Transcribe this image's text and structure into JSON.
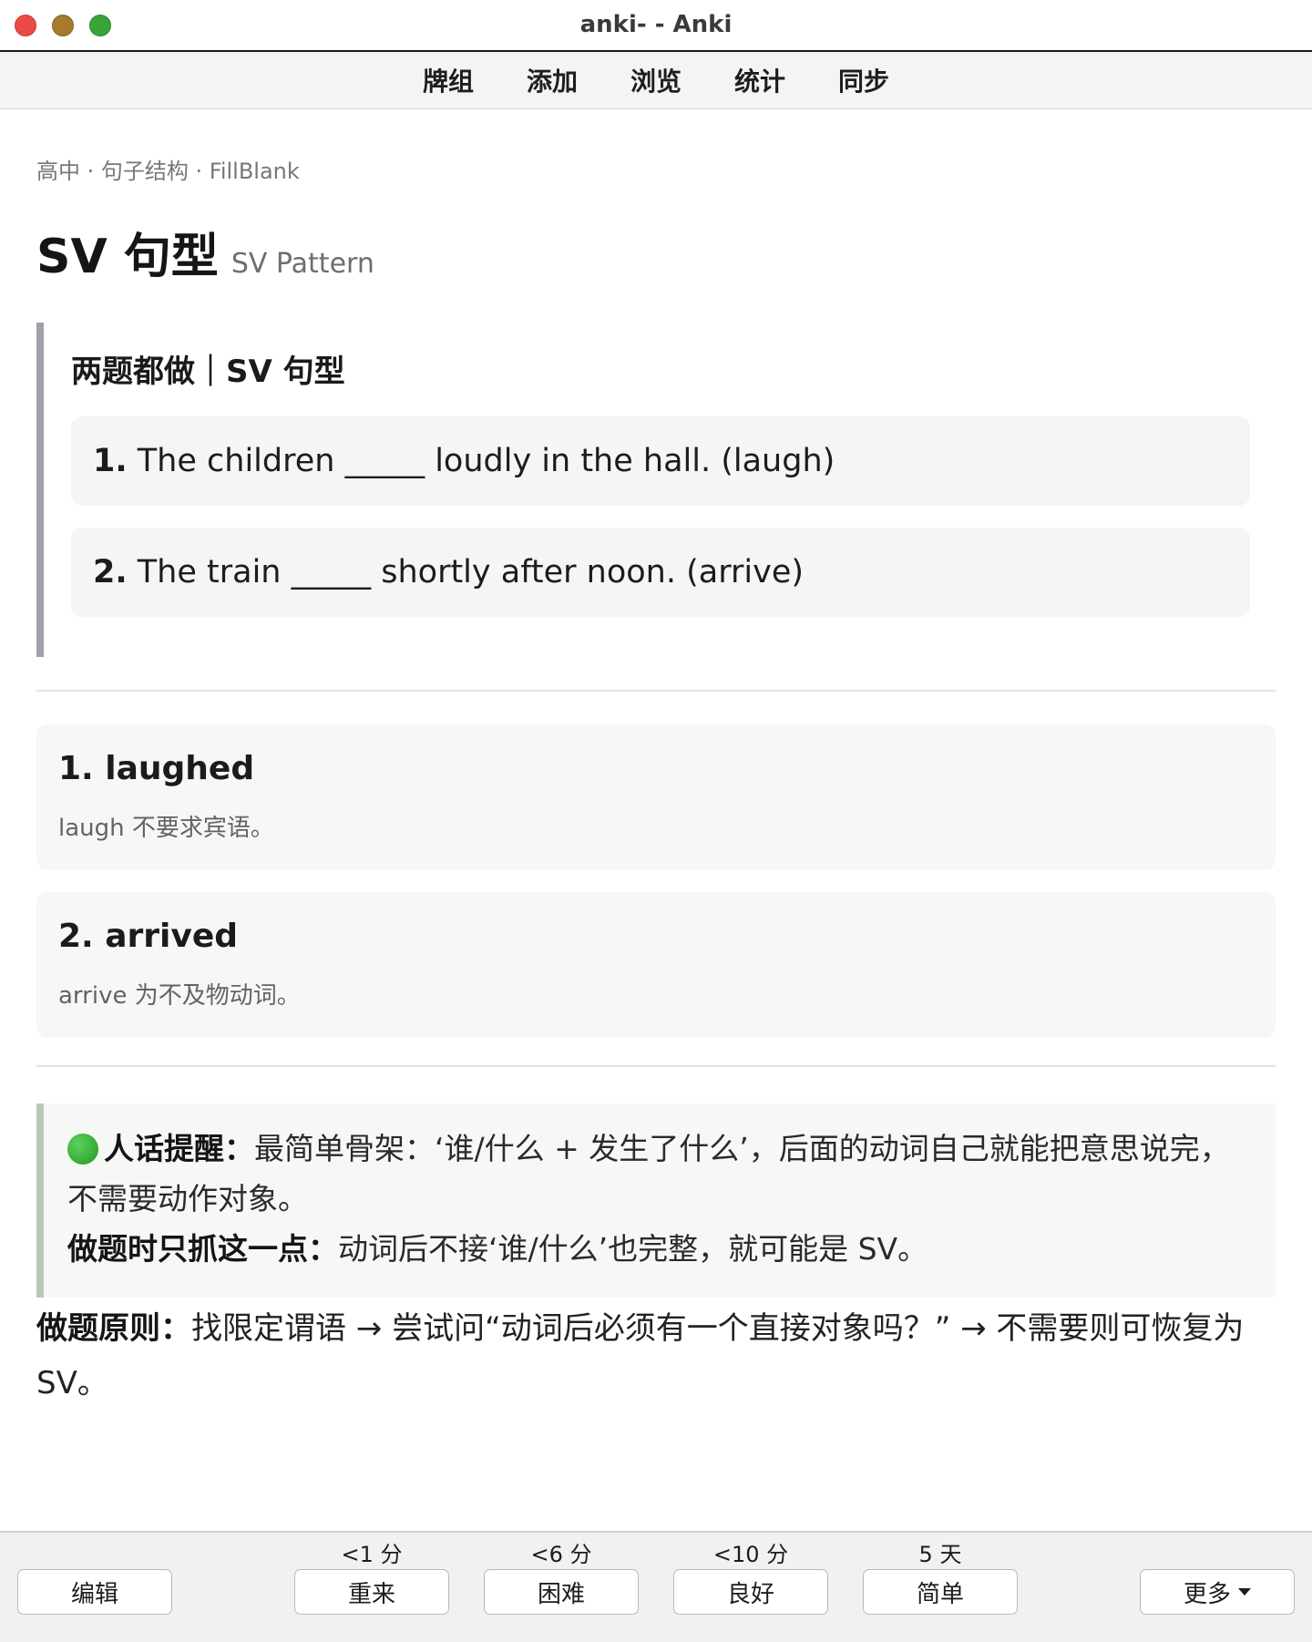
{
  "window": {
    "title": "anki- - Anki"
  },
  "toolbar": {
    "tabs": [
      "牌组",
      "添加",
      "浏览",
      "统计",
      "同步"
    ]
  },
  "card": {
    "breadcrumb": "高中 · 句子结构 · FillBlank",
    "title": "SV 句型",
    "subtitle": "SV Pattern",
    "question_heading": "两题都做｜SV 句型",
    "questions": [
      {
        "num": "1.",
        "text": "The children _____ loudly in the hall. (laugh)"
      },
      {
        "num": "2.",
        "text": "The train _____ shortly after noon. (arrive)"
      }
    ],
    "answers": [
      {
        "title": "1. laughed",
        "note": "laugh 不要求宾语。"
      },
      {
        "title": "2. arrived",
        "note": "arrive 为不及物动词。"
      }
    ],
    "tip": {
      "label1": "人话提醒：",
      "text1": "最简单骨架：‘谁/什么 + 发生了什么’，后面的动词自己就能把意思说完，不需要动作对象。",
      "label2": "做题时只抓这一点：",
      "text2": "动词后不接‘谁/什么’也完整，就可能是 SV。"
    },
    "principle": {
      "label": "做题原则：",
      "text": "找限定谓语 → 尝试问“动词后必须有一个直接对象吗？” → 不需要则可恢复为 SV。"
    }
  },
  "bottom": {
    "edit": "编辑",
    "more": "更多",
    "answers": [
      {
        "time": "<1 分",
        "label": "重来"
      },
      {
        "time": "<6 分",
        "label": "困难"
      },
      {
        "time": "<10 分",
        "label": "良好"
      },
      {
        "time": "5 天",
        "label": "简单"
      }
    ]
  },
  "colors": {
    "tip_dot": "#2eb82e",
    "question_bar": "#a0a0a8",
    "tip_bar": "#b9c9b9"
  }
}
